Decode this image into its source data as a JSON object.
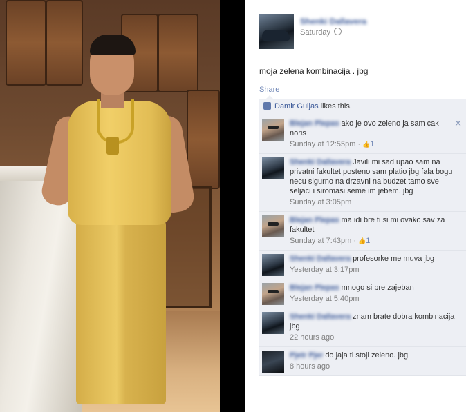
{
  "post": {
    "author": "Shenki Dallavera",
    "time": "Saturday",
    "text": "moja zelena kombinacija . jbg",
    "share_label": "Share"
  },
  "likes": {
    "liker": "Damir Guljas",
    "suffix": "likes this."
  },
  "comments": [
    {
      "author": "Blejan Plepas",
      "text": "ako je ovo zeleno ja sam cak noris",
      "time": "Sunday at 12:55pm",
      "likes": "1",
      "avatar": "user-avatar"
    },
    {
      "author": "Shenki Dallavera",
      "text": "Javili mi sad upao sam na privatni fakultet posteno sam platio jbg fala bogu necu sigurno na drzavni na budzet tamo sve seljaci i siromasi seme im jebem. jbg",
      "time": "Sunday at 3:05pm",
      "likes": "",
      "avatar": "car-avatar"
    },
    {
      "author": "Blejan Plepas",
      "text": "ma idi bre ti si mi ovako sav za fakultet",
      "time": "Sunday at 7:43pm",
      "likes": "1",
      "avatar": "user-avatar"
    },
    {
      "author": "Shenki Dallavera",
      "text": "profesorke me muva jbg",
      "time": "Yesterday at 3:17pm",
      "likes": "",
      "avatar": "car-avatar"
    },
    {
      "author": "Blejan Plepas",
      "text": "mnogo si bre zajeban",
      "time": "Yesterday at 5:40pm",
      "likes": "",
      "avatar": "user-avatar"
    },
    {
      "author": "Shenki Dallavera",
      "text": "znam brate dobra kombinacija jbg",
      "time": "22 hours ago",
      "likes": "",
      "avatar": "car-avatar"
    },
    {
      "author": "Pjetr Pjer",
      "text": "do jaja ti stoji zeleno. jbg",
      "time": "8 hours ago",
      "likes": "",
      "avatar": "dark-avatar"
    }
  ],
  "icons": {
    "close": "close-icon",
    "globe": "globe-icon",
    "thumb": "thumbs-up-icon"
  },
  "colors": {
    "link": "#3b5998",
    "comment_bg": "#edeff4",
    "meta": "#808080"
  }
}
